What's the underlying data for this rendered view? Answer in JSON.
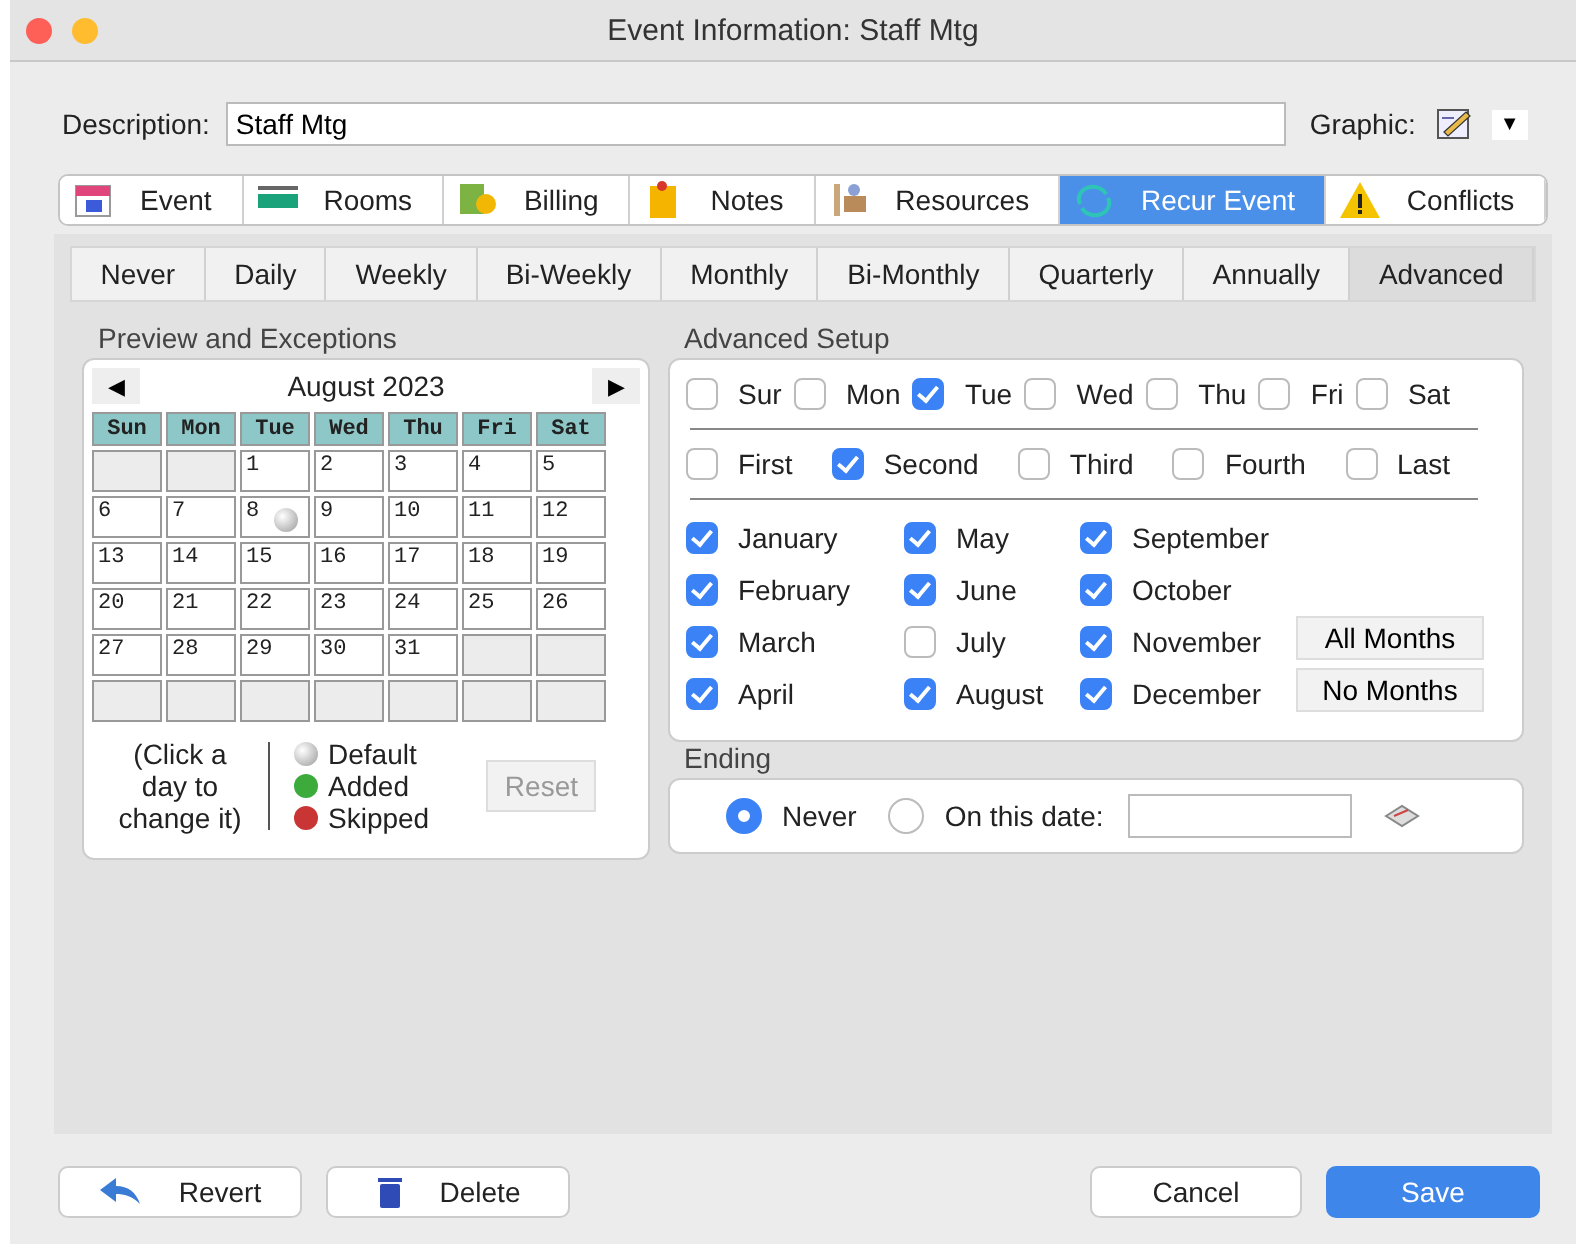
{
  "window": {
    "title": "Event Information: Staff Mtg"
  },
  "description": {
    "label": "Description:",
    "value": "Staff Mtg"
  },
  "graphic": {
    "label": "Graphic:",
    "dropdown": "▼"
  },
  "tabs": [
    {
      "label": "Event",
      "selected": false
    },
    {
      "label": "Rooms",
      "selected": false
    },
    {
      "label": "Billing",
      "selected": false
    },
    {
      "label": "Notes",
      "selected": false
    },
    {
      "label": "Resources",
      "selected": false
    },
    {
      "label": "Recur Event",
      "selected": true
    },
    {
      "label": "Conflicts",
      "selected": false
    }
  ],
  "recur_tabs": [
    {
      "label": "Never",
      "selected": false
    },
    {
      "label": "Daily",
      "selected": false
    },
    {
      "label": "Weekly",
      "selected": false
    },
    {
      "label": "Bi-Weekly",
      "selected": false
    },
    {
      "label": "Monthly",
      "selected": false
    },
    {
      "label": "Bi-Monthly",
      "selected": false
    },
    {
      "label": "Quarterly",
      "selected": false
    },
    {
      "label": "Annually",
      "selected": false
    },
    {
      "label": "Advanced",
      "selected": true
    }
  ],
  "preview": {
    "title": "Preview and Exceptions",
    "prev": "◀",
    "next": "▶",
    "month": "August 2023",
    "weekdays": [
      "Sun",
      "Mon",
      "Tue",
      "Wed",
      "Thu",
      "Fri",
      "Sat"
    ],
    "weeks": [
      [
        {
          "kind": "empty"
        },
        {
          "kind": "empty"
        },
        {
          "kind": "day",
          "day": "1"
        },
        {
          "kind": "day",
          "day": "2"
        },
        {
          "kind": "day",
          "day": "3"
        },
        {
          "kind": "day",
          "day": "4"
        },
        {
          "kind": "day",
          "day": "5"
        }
      ],
      [
        {
          "kind": "day",
          "day": "6"
        },
        {
          "kind": "day",
          "day": "7"
        },
        {
          "kind": "day",
          "day": "8",
          "marker": {
            "kind": "default"
          }
        },
        {
          "kind": "day",
          "day": "9"
        },
        {
          "kind": "day",
          "day": "10"
        },
        {
          "kind": "day",
          "day": "11"
        },
        {
          "kind": "day",
          "day": "12"
        }
      ],
      [
        {
          "kind": "day",
          "day": "13"
        },
        {
          "kind": "day",
          "day": "14"
        },
        {
          "kind": "day",
          "day": "15"
        },
        {
          "kind": "day",
          "day": "16"
        },
        {
          "kind": "day",
          "day": "17"
        },
        {
          "kind": "day",
          "day": "18"
        },
        {
          "kind": "day",
          "day": "19"
        }
      ],
      [
        {
          "kind": "day",
          "day": "20"
        },
        {
          "kind": "day",
          "day": "21"
        },
        {
          "kind": "day",
          "day": "22"
        },
        {
          "kind": "day",
          "day": "23"
        },
        {
          "kind": "day",
          "day": "24"
        },
        {
          "kind": "day",
          "day": "25"
        },
        {
          "kind": "day",
          "day": "26"
        }
      ],
      [
        {
          "kind": "day",
          "day": "27"
        },
        {
          "kind": "day",
          "day": "28"
        },
        {
          "kind": "day",
          "day": "29"
        },
        {
          "kind": "day",
          "day": "30"
        },
        {
          "kind": "day",
          "day": "31"
        },
        {
          "kind": "empty"
        },
        {
          "kind": "empty"
        }
      ],
      [
        {
          "kind": "empty"
        },
        {
          "kind": "empty"
        },
        {
          "kind": "empty"
        },
        {
          "kind": "empty"
        },
        {
          "kind": "empty"
        },
        {
          "kind": "empty"
        },
        {
          "kind": "empty"
        }
      ]
    ],
    "hint": "(Click a day to change it)",
    "legend": [
      {
        "kind": "default",
        "label": "Default"
      },
      {
        "kind": "added",
        "label": "Added"
      },
      {
        "kind": "skipped",
        "label": "Skipped"
      }
    ],
    "reset": {
      "label": "Reset",
      "disabled": true
    }
  },
  "advanced": {
    "title": "Advanced Setup",
    "days": [
      {
        "label": "Sur",
        "checked": false
      },
      {
        "label": "Mon",
        "checked": false
      },
      {
        "label": "Tue",
        "checked": true
      },
      {
        "label": "Wed",
        "checked": false
      },
      {
        "label": "Thu",
        "checked": false
      },
      {
        "label": "Fri",
        "checked": false
      },
      {
        "label": "Sat",
        "checked": false
      }
    ],
    "ordinals": [
      {
        "label": "First",
        "checked": false
      },
      {
        "label": "Second",
        "checked": true
      },
      {
        "label": "Third",
        "checked": false
      },
      {
        "label": "Fourth",
        "checked": false
      },
      {
        "label": "Last",
        "checked": false
      }
    ],
    "month_columns": [
      [
        {
          "label": "January",
          "checked": true
        },
        {
          "label": "February",
          "checked": true
        },
        {
          "label": "March",
          "checked": true
        },
        {
          "label": "April",
          "checked": true
        }
      ],
      [
        {
          "label": "May",
          "checked": true
        },
        {
          "label": "June",
          "checked": true
        },
        {
          "label": "July",
          "checked": false
        },
        {
          "label": "August",
          "checked": true
        }
      ],
      [
        {
          "label": "September",
          "checked": true
        },
        {
          "label": "October",
          "checked": true
        },
        {
          "label": "November",
          "checked": true
        },
        {
          "label": "December",
          "checked": true
        }
      ]
    ],
    "buttons": [
      "All Months",
      "No Months"
    ]
  },
  "ending": {
    "title": "Ending",
    "options": [
      {
        "label": "Never",
        "selected": true
      },
      {
        "label": "On this date:",
        "selected": false
      }
    ]
  },
  "buttons": {
    "revert": "Revert",
    "delete": "Delete",
    "cancel": "Cancel",
    "save": "Save"
  }
}
